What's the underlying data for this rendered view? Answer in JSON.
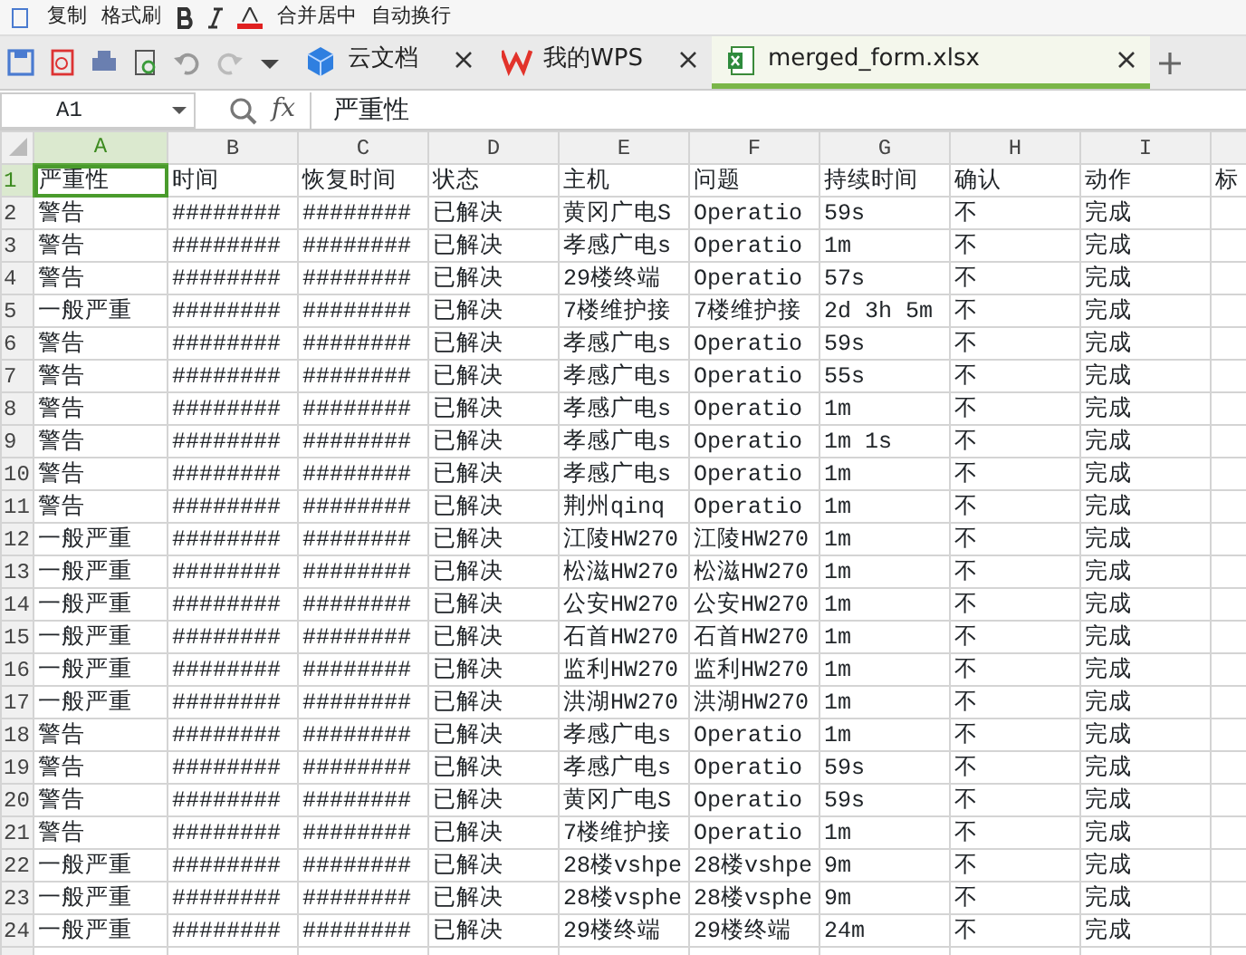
{
  "ribbon": {
    "items": [
      "复制",
      "格式刷",
      "合并居中",
      "自动换行"
    ]
  },
  "tabs": [
    {
      "label": "云文档",
      "kind": "cloud",
      "selected": false
    },
    {
      "label": "我的WPS",
      "kind": "wps",
      "selected": false
    },
    {
      "label": "merged_form.xlsx",
      "kind": "sheet",
      "selected": true
    }
  ],
  "name_box": "A1",
  "function_label": "fx",
  "formula": "严重性",
  "columns": [
    {
      "label": "A",
      "selected": true
    },
    {
      "label": "B",
      "selected": false
    },
    {
      "label": "C",
      "selected": false
    },
    {
      "label": "D",
      "selected": false
    },
    {
      "label": "E",
      "selected": false
    },
    {
      "label": "F",
      "selected": false
    },
    {
      "label": "G",
      "selected": false
    },
    {
      "label": "H",
      "selected": false
    },
    {
      "label": "I",
      "selected": false
    }
  ],
  "rows": [
    {
      "number": "1",
      "selected": true,
      "cells": [
        "严重性",
        "时间",
        "恢复时间",
        "状态",
        "主机",
        "问题",
        "持续时间",
        "确认",
        "动作",
        "标"
      ]
    },
    {
      "number": "2",
      "selected": false,
      "cells": [
        "警告",
        "########",
        "########",
        "已解决",
        "黄冈广电S",
        "Operatio",
        "59s",
        "不",
        "完成"
      ]
    },
    {
      "number": "3",
      "selected": false,
      "cells": [
        "警告",
        "########",
        "########",
        "已解决",
        "孝感广电s",
        "Operatio",
        "1m",
        "不",
        "完成"
      ]
    },
    {
      "number": "4",
      "selected": false,
      "cells": [
        "警告",
        "########",
        "########",
        "已解决",
        "29楼终端",
        "Operatio",
        "57s",
        "不",
        "完成"
      ]
    },
    {
      "number": "5",
      "selected": false,
      "cells": [
        "一般严重",
        "########",
        "########",
        "已解决",
        "7楼维护接",
        "7楼维护接",
        "2d 3h 5m",
        "不",
        "完成"
      ]
    },
    {
      "number": "6",
      "selected": false,
      "cells": [
        "警告",
        "########",
        "########",
        "已解决",
        "孝感广电s",
        "Operatio",
        "59s",
        "不",
        "完成"
      ]
    },
    {
      "number": "7",
      "selected": false,
      "cells": [
        "警告",
        "########",
        "########",
        "已解决",
        "孝感广电s",
        "Operatio",
        "55s",
        "不",
        "完成"
      ]
    },
    {
      "number": "8",
      "selected": false,
      "cells": [
        "警告",
        "########",
        "########",
        "已解决",
        "孝感广电s",
        "Operatio",
        "1m",
        "不",
        "完成"
      ]
    },
    {
      "number": "9",
      "selected": false,
      "cells": [
        "警告",
        "########",
        "########",
        "已解决",
        "孝感广电s",
        "Operatio",
        "1m 1s",
        "不",
        "完成"
      ]
    },
    {
      "number": "10",
      "selected": false,
      "cells": [
        "警告",
        "########",
        "########",
        "已解决",
        "孝感广电s",
        "Operatio",
        "1m",
        "不",
        "完成"
      ]
    },
    {
      "number": "11",
      "selected": false,
      "cells": [
        "警告",
        "########",
        "########",
        "已解决",
        "荆州qinq",
        "Operatio",
        "1m",
        "不",
        "完成"
      ]
    },
    {
      "number": "12",
      "selected": false,
      "cells": [
        "一般严重",
        "########",
        "########",
        "已解决",
        "江陵HW270",
        "江陵HW270",
        "1m",
        "不",
        "完成"
      ]
    },
    {
      "number": "13",
      "selected": false,
      "cells": [
        "一般严重",
        "########",
        "########",
        "已解决",
        "松滋HW270",
        "松滋HW270",
        "1m",
        "不",
        "完成"
      ]
    },
    {
      "number": "14",
      "selected": false,
      "cells": [
        "一般严重",
        "########",
        "########",
        "已解决",
        "公安HW270",
        "公安HW270",
        "1m",
        "不",
        "完成"
      ]
    },
    {
      "number": "15",
      "selected": false,
      "cells": [
        "一般严重",
        "########",
        "########",
        "已解决",
        "石首HW270",
        "石首HW270",
        "1m",
        "不",
        "完成"
      ]
    },
    {
      "number": "16",
      "selected": false,
      "cells": [
        "一般严重",
        "########",
        "########",
        "已解决",
        "监利HW270",
        "监利HW270",
        "1m",
        "不",
        "完成"
      ]
    },
    {
      "number": "17",
      "selected": false,
      "cells": [
        "一般严重",
        "########",
        "########",
        "已解决",
        "洪湖HW270",
        "洪湖HW270",
        "1m",
        "不",
        "完成"
      ]
    },
    {
      "number": "18",
      "selected": false,
      "cells": [
        "警告",
        "########",
        "########",
        "已解决",
        "孝感广电s",
        "Operatio",
        "1m",
        "不",
        "完成"
      ]
    },
    {
      "number": "19",
      "selected": false,
      "cells": [
        "警告",
        "########",
        "########",
        "已解决",
        "孝感广电s",
        "Operatio",
        "59s",
        "不",
        "完成"
      ]
    },
    {
      "number": "20",
      "selected": false,
      "cells": [
        "警告",
        "########",
        "########",
        "已解决",
        "黄冈广电S",
        "Operatio",
        "59s",
        "不",
        "完成"
      ]
    },
    {
      "number": "21",
      "selected": false,
      "cells": [
        "警告",
        "########",
        "########",
        "已解决",
        "7楼维护接",
        "Operatio",
        "1m",
        "不",
        "完成"
      ]
    },
    {
      "number": "22",
      "selected": false,
      "cells": [
        "一般严重",
        "########",
        "########",
        "已解决",
        "28楼vshpe",
        "28楼vshpe",
        "9m",
        "不",
        "完成"
      ]
    },
    {
      "number": "23",
      "selected": false,
      "cells": [
        "一般严重",
        "########",
        "########",
        "已解决",
        "28楼vsphe",
        "28楼vsphe",
        "9m",
        "不",
        "完成"
      ]
    },
    {
      "number": "24",
      "selected": false,
      "cells": [
        "一般严重",
        "########",
        "########",
        "已解决",
        "29楼终端",
        "29楼终端",
        "24m",
        "不",
        "完成"
      ]
    }
  ]
}
